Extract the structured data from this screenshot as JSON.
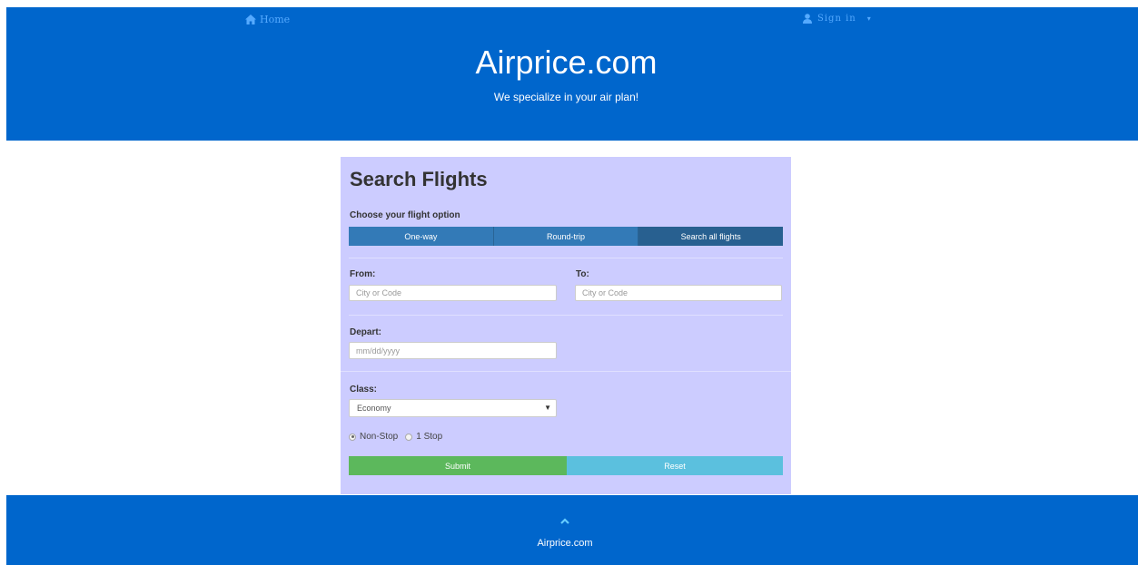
{
  "nav": {
    "home_label": "Home",
    "sign_in_label": "Sign in",
    "caret": "▾"
  },
  "header": {
    "title": "Airprice.com",
    "subtitle": "We specialize in your air plan!"
  },
  "form": {
    "title": "Search Flights",
    "option_label": "Choose your flight option",
    "options": [
      "One-way",
      "Round-trip",
      "Search all flights"
    ],
    "active_option": "Search all flights",
    "from_label": "From:",
    "from_placeholder": "City or Code",
    "to_label": "To:",
    "to_placeholder": "City or Code",
    "depart_label": "Depart:",
    "depart_placeholder": "mm/dd/yyyy",
    "class_label": "Class:",
    "class_value": "Economy",
    "stops": [
      {
        "label": "Non-Stop",
        "checked": true
      },
      {
        "label": "1 Stop",
        "checked": false
      }
    ],
    "submit_label": "Submit",
    "reset_label": "Reset"
  },
  "footer": {
    "name": "Airprice.com"
  },
  "colors": {
    "header_bg": "#0066cc",
    "card_bg": "#ccccff",
    "segment": "#337ab7",
    "submit": "#5cb85c",
    "reset": "#5bc0de"
  }
}
